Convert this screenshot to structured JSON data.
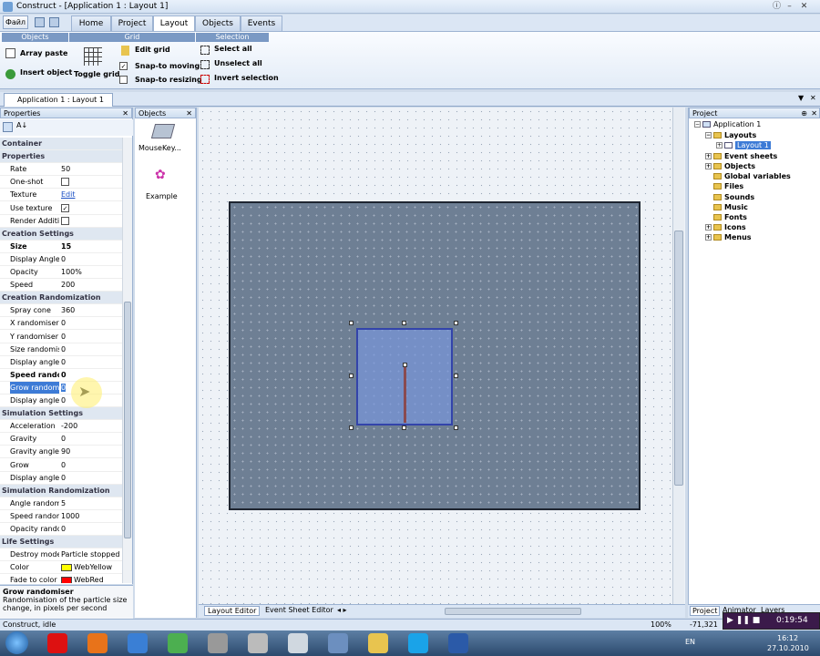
{
  "window": {
    "title": "Construct - [Application 1 : Layout 1]"
  },
  "qat": {
    "file_label": "Файл"
  },
  "ribbon_tabs": [
    "Home",
    "Project",
    "Layout",
    "Objects",
    "Events"
  ],
  "ribbon": {
    "groups": [
      "Objects",
      "Grid",
      "Selection"
    ],
    "array_paste": "Array paste",
    "insert_object": "Insert object",
    "toggle_grid": "Toggle grid",
    "edit_grid": "Edit grid",
    "snap_moving": "Snap-to moving",
    "snap_resizing": "Snap-to resizing",
    "select_all": "Select all",
    "unselect_all": "Unselect all",
    "invert_selection": "Invert selection"
  },
  "doc_tab": "Application 1 : Layout 1",
  "properties": {
    "title": "Properties",
    "rows": [
      {
        "n": "Container",
        "v": "",
        "hdr": true
      },
      {
        "n": "Properties",
        "v": "",
        "hdr": true
      },
      {
        "n": "Rate",
        "v": "50"
      },
      {
        "n": "One-shot",
        "v": "",
        "cb": false
      },
      {
        "n": "Texture",
        "v": "Edit",
        "link": true
      },
      {
        "n": "Use texture",
        "v": "",
        "cb": true
      },
      {
        "n": "Render Additive",
        "v": "",
        "cb": false
      },
      {
        "n": "Creation Settings",
        "v": "",
        "hdr": true
      },
      {
        "n": "Size",
        "v": "15",
        "bold": true
      },
      {
        "n": "Display Angle",
        "v": "0"
      },
      {
        "n": "Opacity",
        "v": "100%"
      },
      {
        "n": "Speed",
        "v": "200"
      },
      {
        "n": "Creation Randomization",
        "v": "",
        "hdr": true
      },
      {
        "n": "Spray cone",
        "v": "360"
      },
      {
        "n": "X randomiser",
        "v": "0"
      },
      {
        "n": "Y randomiser",
        "v": "0"
      },
      {
        "n": "Size randomiser",
        "v": "0"
      },
      {
        "n": "Display angle",
        "v": "0"
      },
      {
        "n": "Speed randomiser",
        "v": "0",
        "bold": true
      },
      {
        "n": "Grow randomiser",
        "v": "0",
        "sel": true
      },
      {
        "n": "Display angle",
        "v": "0"
      },
      {
        "n": "Simulation Settings",
        "v": "",
        "hdr": true
      },
      {
        "n": "Acceleration",
        "v": "-200"
      },
      {
        "n": "Gravity",
        "v": "0"
      },
      {
        "n": "Gravity angle",
        "v": "90"
      },
      {
        "n": "Grow",
        "v": "0"
      },
      {
        "n": "Display angle",
        "v": "0"
      },
      {
        "n": "Simulation Randomization",
        "v": "",
        "hdr": true
      },
      {
        "n": "Angle randomiser",
        "v": "5"
      },
      {
        "n": "Speed randomiser",
        "v": "1000"
      },
      {
        "n": "Opacity randomiser",
        "v": "0"
      },
      {
        "n": "Life Settings",
        "v": "",
        "hdr": true
      },
      {
        "n": "Destroy mode",
        "v": "Particle stopped"
      },
      {
        "n": "Color",
        "v": "WebYellow",
        "color": "#ffff00"
      },
      {
        "n": "Fade to color",
        "v": "WebRed",
        "color": "#ff0000"
      }
    ],
    "desc_title": "Grow randomiser",
    "desc_text": "Randomisation of the particle size change, in pixels per second"
  },
  "objects": {
    "title": "Objects",
    "items": [
      "MouseKey...",
      "Example"
    ]
  },
  "editor_tabs": [
    "Layout Editor",
    "Event Sheet Editor"
  ],
  "project": {
    "title": "Project",
    "root": "Application 1",
    "items": [
      "Layouts",
      "Layout 1",
      "Event sheets",
      "Objects",
      "Global variables",
      "Files",
      "Sounds",
      "Music",
      "Fonts",
      "Icons",
      "Menus"
    ],
    "tabs": [
      "Project",
      "Animator",
      "Layers"
    ]
  },
  "status": {
    "text": "Construct, idle",
    "zoom": "100%",
    "coords": "-71,321"
  },
  "tray": {
    "lang": "EN",
    "time": "16:12",
    "date": "27.10.2010",
    "recorder": "0:19:54"
  }
}
